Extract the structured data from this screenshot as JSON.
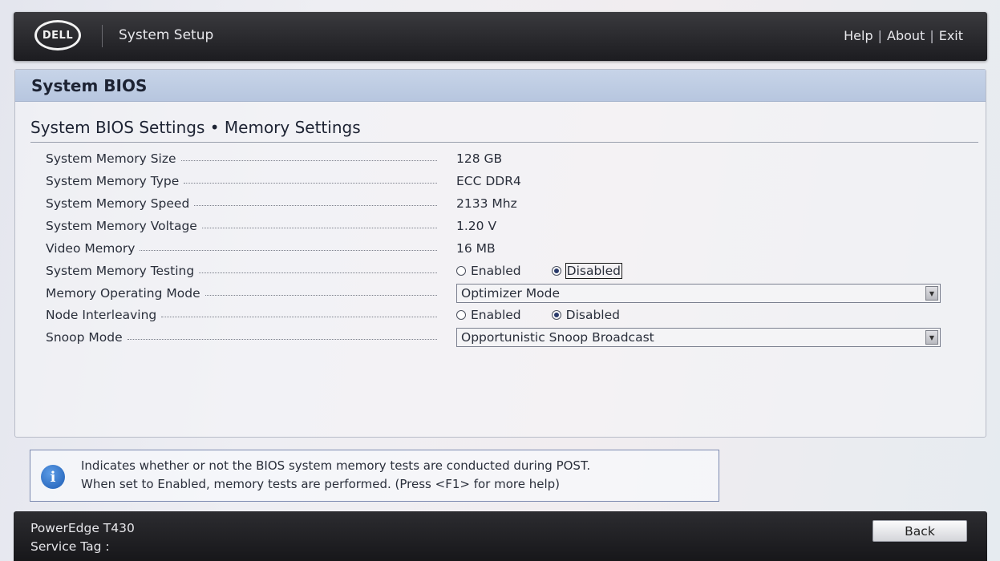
{
  "header": {
    "logo_text": "DELL",
    "app_title": "System Setup",
    "links": [
      "Help",
      "About",
      "Exit"
    ],
    "separator": "|"
  },
  "panel": {
    "title": "System BIOS",
    "section_title": "System BIOS Settings • Memory Settings"
  },
  "settings": {
    "memory_size": {
      "label": "System Memory Size",
      "value": "128 GB"
    },
    "memory_type": {
      "label": "System Memory Type",
      "value": "ECC DDR4"
    },
    "memory_speed": {
      "label": "System Memory Speed",
      "value": "2133 Mhz"
    },
    "memory_voltage": {
      "label": "System Memory Voltage",
      "value": "1.20 V"
    },
    "video_memory": {
      "label": "Video Memory",
      "value": "16 MB"
    },
    "memory_testing": {
      "label": "System Memory Testing",
      "options": [
        "Enabled",
        "Disabled"
      ],
      "selected": "Disabled"
    },
    "operating_mode": {
      "label": "Memory Operating Mode",
      "value": "Optimizer Mode"
    },
    "node_interleaving": {
      "label": "Node Interleaving",
      "options": [
        "Enabled",
        "Disabled"
      ],
      "selected": "Disabled"
    },
    "snoop_mode": {
      "label": "Snoop Mode",
      "value": "Opportunistic Snoop Broadcast"
    }
  },
  "help": {
    "line1": "Indicates whether or not the BIOS system memory tests are conducted during POST.",
    "line2": "When set to Enabled, memory tests are performed. (Press <F1> for more help)"
  },
  "footer": {
    "model": "PowerEdge T430",
    "service_tag_label": "Service Tag :",
    "back_label": "Back"
  }
}
